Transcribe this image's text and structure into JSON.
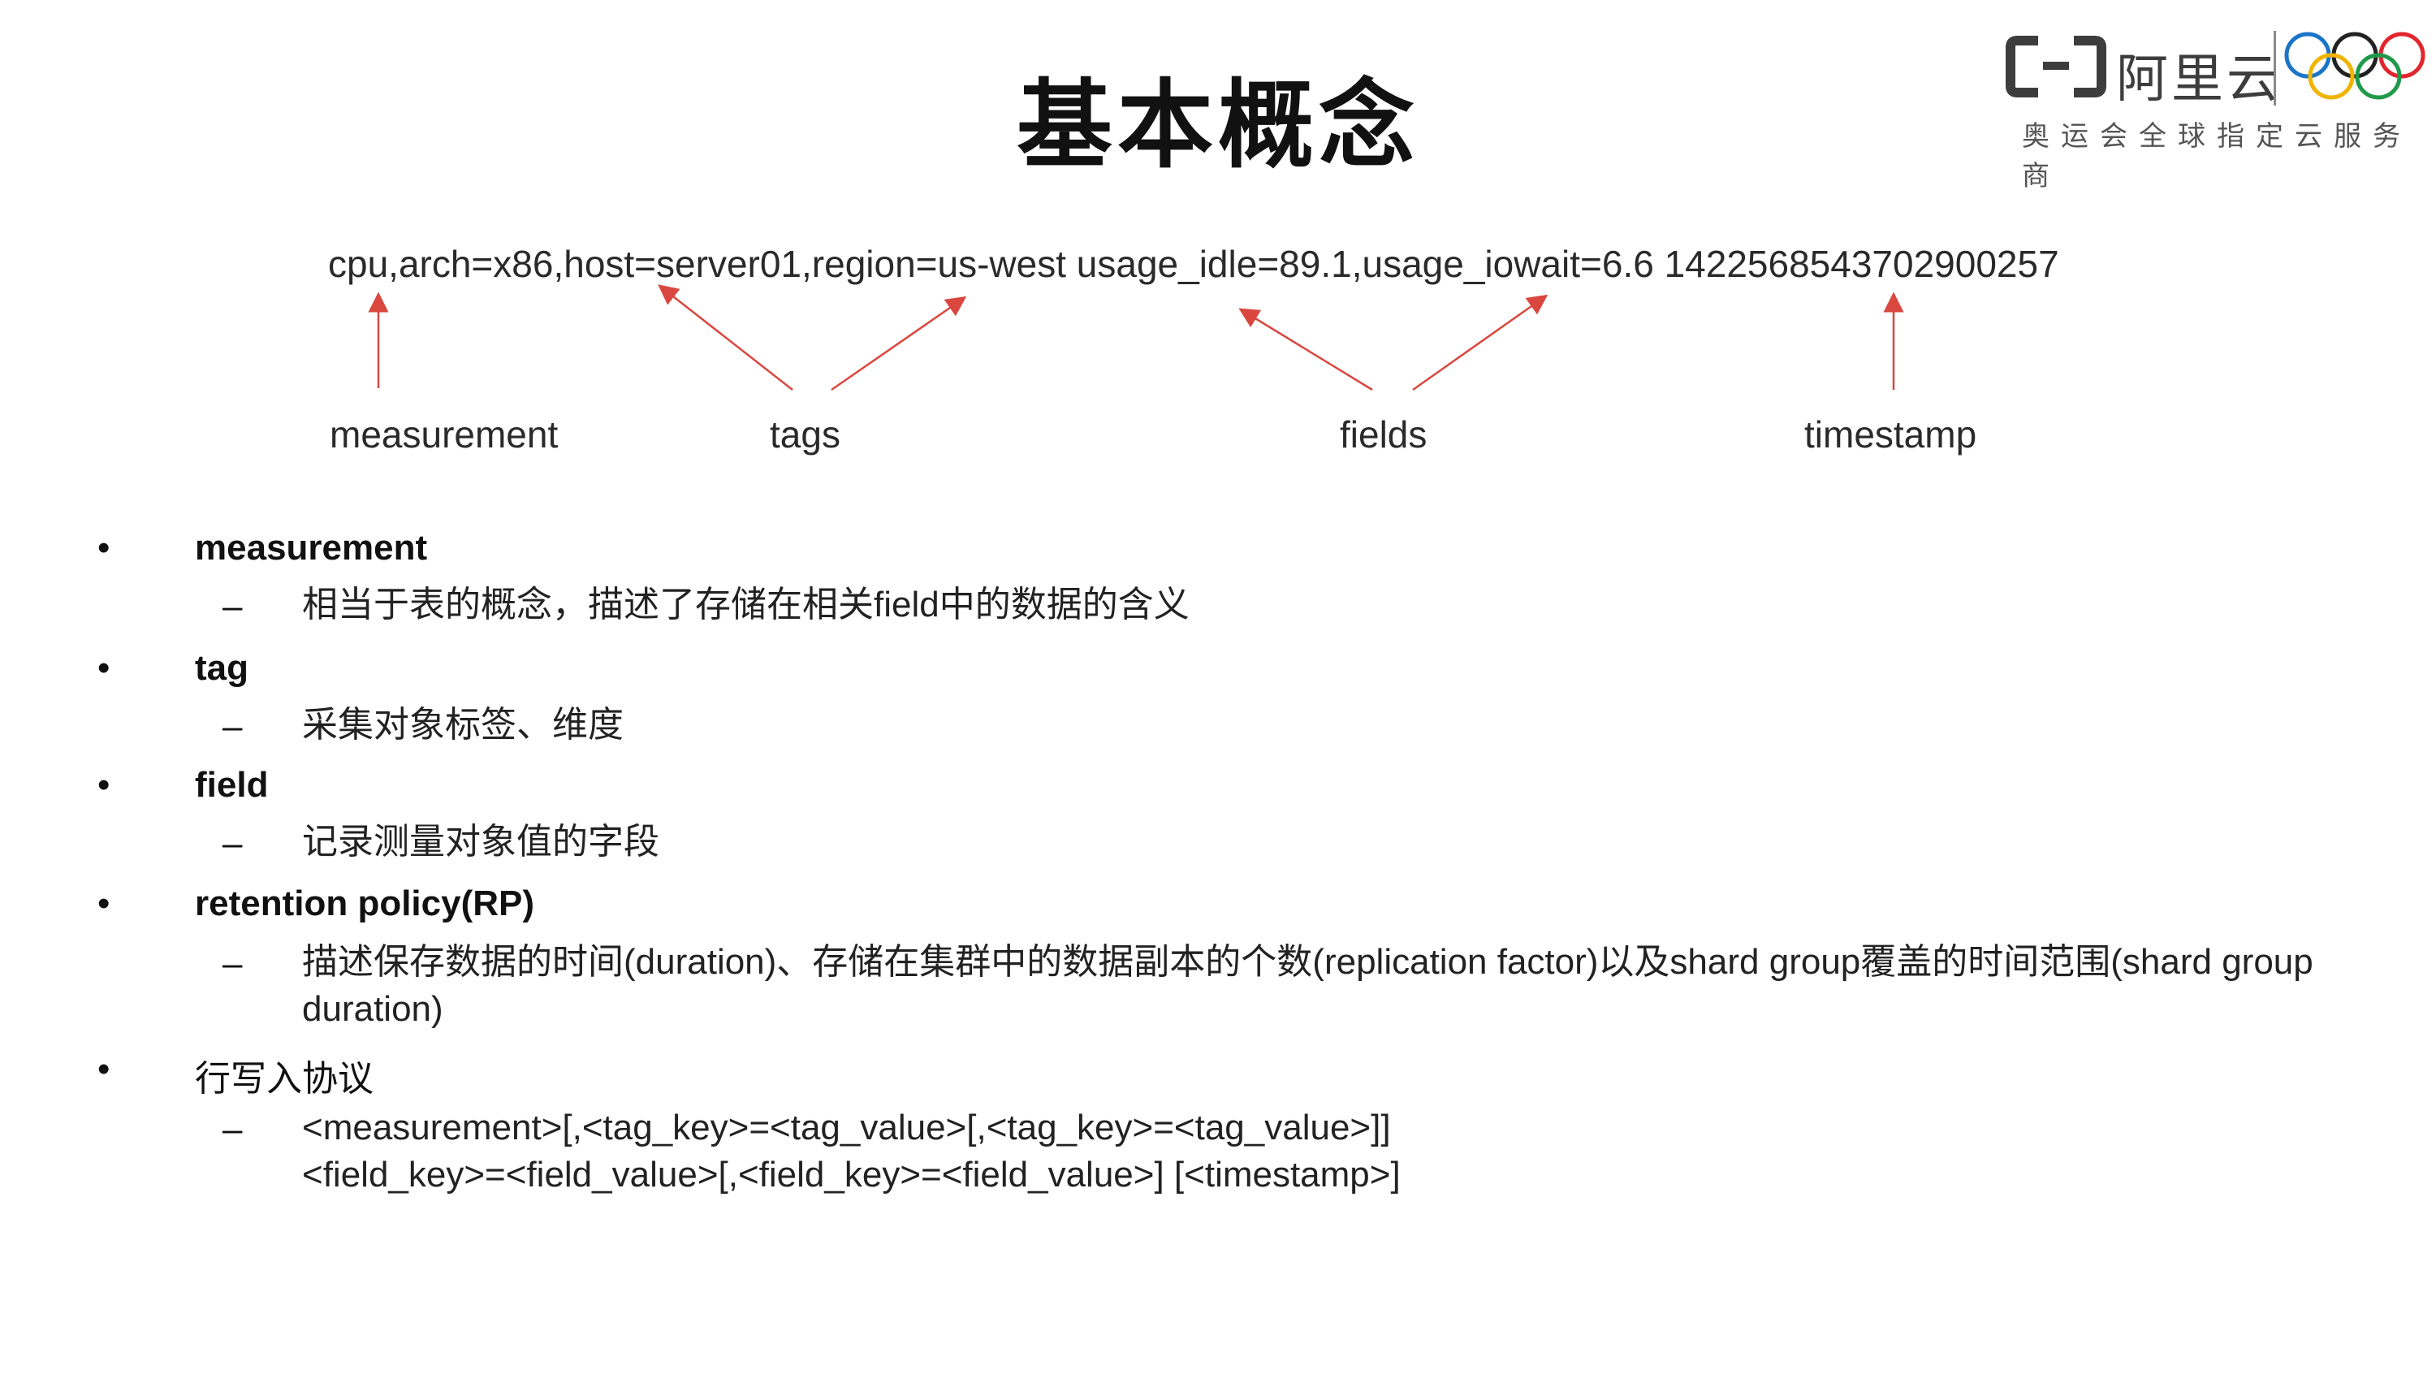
{
  "title": "基本概念",
  "logo": {
    "brand_text": "阿里云",
    "subtitle": "奥运会全球指定云服务商",
    "ring_colors": [
      "#1a75c8",
      "#f0b400",
      "#222222",
      "#1f9a4a",
      "#e2262e"
    ]
  },
  "example": {
    "line": "cpu,arch=x86,host=server01,region=us-west usage_idle=89.1,usage_iowait=6.6 1422568543702900257",
    "labels": {
      "measurement": "measurement",
      "tags": "tags",
      "fields": "fields",
      "timestamp": "timestamp"
    },
    "arrow_color": "#d9473f"
  },
  "items": [
    {
      "title": "measurement",
      "desc": "相当于表的概念，描述了存储在相关field中的数据的含义"
    },
    {
      "title": "tag",
      "desc": "采集对象标签、维度"
    },
    {
      "title": "field",
      "desc": "记录测量对象值的字段"
    },
    {
      "title": "retention policy(RP)",
      "desc": "描述保存数据的时间(duration)、存储在集群中的数据副本的个数(replication factor)以及shard group覆盖的时间范围(shard group duration)"
    },
    {
      "title": "行写入协议",
      "desc_line1": "<measurement>[,<tag_key>=<tag_value>[,<tag_key>=<tag_value>]]",
      "desc_line2": "<field_key>=<field_value>[,<field_key>=<field_value>] [<timestamp>]"
    }
  ]
}
